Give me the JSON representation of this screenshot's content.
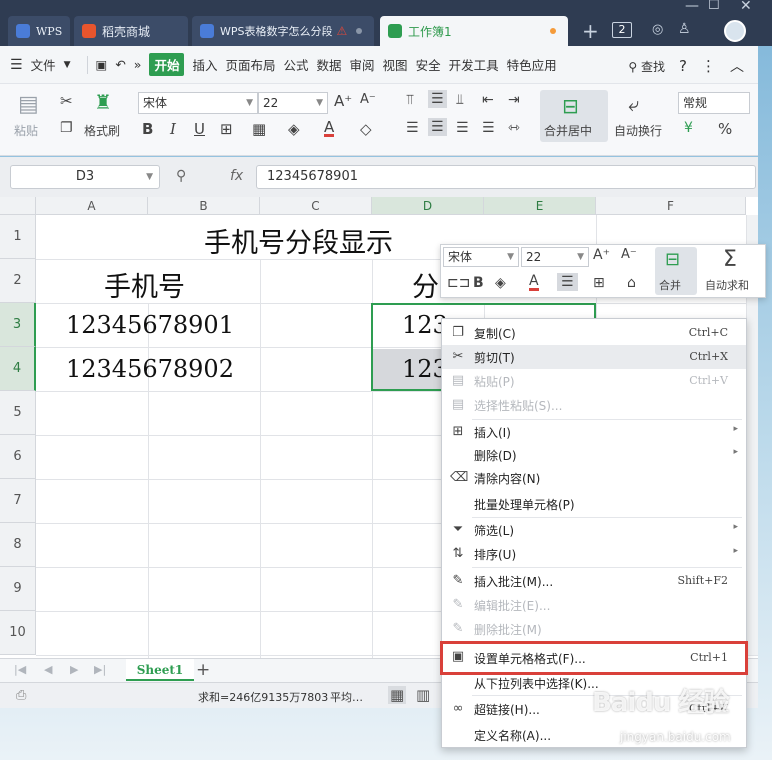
{
  "tabs": {
    "wps": "WPS",
    "shop": "稻壳商城",
    "doc": "WPS表格数字怎么分段",
    "active": "工作簿1",
    "page_count": "2"
  },
  "menu": {
    "file": "文件",
    "items": [
      "开始",
      "插入",
      "页面布局",
      "公式",
      "数据",
      "审阅",
      "视图",
      "安全",
      "开发工具",
      "特色应用"
    ],
    "search": "查找"
  },
  "ribbon": {
    "paste": "粘贴",
    "format_painter": "格式刷",
    "font_name": "宋体",
    "font_size": "22",
    "merge_center": "合并居中",
    "wrap": "自动换行",
    "number_format": "常规",
    "percent": "%"
  },
  "formula_bar": {
    "cell_ref": "D3",
    "fx": "fx",
    "value": "12345678901"
  },
  "grid": {
    "columns": [
      "A",
      "B",
      "C",
      "D",
      "E",
      "F"
    ],
    "rows": [
      "1",
      "2",
      "3",
      "4",
      "5",
      "6",
      "7",
      "8",
      "9",
      "10"
    ],
    "title": "手机号分段显示",
    "header_a": "手机号",
    "header_d": "分",
    "a3": "12345678901",
    "a4": "12345678902",
    "d3": "123",
    "d4": "123"
  },
  "sheet": {
    "tab": "Sheet1",
    "add": "+"
  },
  "status": {
    "sum": "求和=246亿9135万7803",
    "avg": "平均…"
  },
  "mini_toolbar": {
    "font": "宋体",
    "size": "22",
    "merge": "合并",
    "autosum": "自动求和",
    "bold": "B"
  },
  "context_menu": [
    {
      "label": "复制(C)",
      "shortcut": "Ctrl+C",
      "icon": "copy-icon",
      "glyph": "❐",
      "enabled": true
    },
    {
      "label": "剪切(T)",
      "shortcut": "Ctrl+X",
      "icon": "scissors-icon",
      "glyph": "✂",
      "enabled": true
    },
    {
      "label": "粘贴(P)",
      "shortcut": "Ctrl+V",
      "icon": "paste-icon",
      "glyph": "▤",
      "enabled": false
    },
    {
      "label": "选择性粘贴(S)...",
      "shortcut": "",
      "icon": "paste-special-icon",
      "glyph": "▤",
      "enabled": false
    },
    {
      "label": "插入(I)",
      "shortcut": "",
      "icon": "insert-icon",
      "glyph": "⊞",
      "enabled": true,
      "submenu": true
    },
    {
      "label": "删除(D)",
      "shortcut": "",
      "icon": "",
      "glyph": "",
      "enabled": true,
      "submenu": true
    },
    {
      "label": "清除内容(N)",
      "shortcut": "",
      "icon": "eraser-icon",
      "glyph": "⌫",
      "enabled": true
    },
    {
      "label": "批量处理单元格(P)",
      "shortcut": "",
      "icon": "",
      "glyph": "",
      "enabled": true
    },
    {
      "label": "筛选(L)",
      "shortcut": "",
      "icon": "filter-icon",
      "glyph": "⏷",
      "enabled": true,
      "submenu": true
    },
    {
      "label": "排序(U)",
      "shortcut": "",
      "icon": "sort-icon",
      "glyph": "⇅",
      "enabled": true,
      "submenu": true
    },
    {
      "label": "插入批注(M)...",
      "shortcut": "Shift+F2",
      "icon": "comment-icon",
      "glyph": "✎",
      "enabled": true
    },
    {
      "label": "编辑批注(E)...",
      "shortcut": "",
      "icon": "edit-comment-icon",
      "glyph": "✎",
      "enabled": false
    },
    {
      "label": "删除批注(M)",
      "shortcut": "",
      "icon": "delete-comment-icon",
      "glyph": "✎",
      "enabled": false
    },
    {
      "label": "设置单元格格式(F)...",
      "shortcut": "Ctrl+1",
      "icon": "format-cells-icon",
      "glyph": "▣",
      "enabled": true
    },
    {
      "label": "从下拉列表中选择(K)...",
      "shortcut": "",
      "icon": "",
      "glyph": "",
      "enabled": true
    },
    {
      "label": "超链接(H)...",
      "shortcut": "Ctrl+K",
      "icon": "link-icon",
      "glyph": "∞",
      "enabled": true
    },
    {
      "label": "定义名称(A)...",
      "shortcut": "",
      "icon": "",
      "glyph": "",
      "enabled": true
    }
  ],
  "watermark": {
    "logo": "Baidu 经验",
    "url": "jingyan.baidu.com"
  },
  "colors": {
    "accent": "#2e9d51",
    "highlight_border": "#d9403a",
    "titlebar": "#2f3c52"
  }
}
